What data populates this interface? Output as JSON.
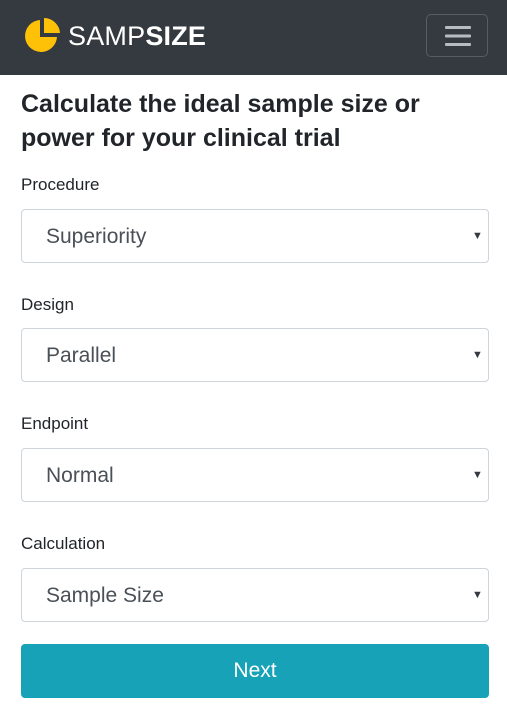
{
  "navbar": {
    "brand_light": "SAMP",
    "brand_bold": "SIZE",
    "logo_icon": "pie-chart-icon",
    "toggler_icon": "hamburger-icon",
    "logo_color": "#ffc107",
    "background": "#343a40"
  },
  "main": {
    "heading": "Calculate the ideal sample size or power for your clinical trial"
  },
  "form": {
    "procedure": {
      "label": "Procedure",
      "value": "Superiority",
      "caret": "▼"
    },
    "design": {
      "label": "Design",
      "value": "Parallel",
      "caret": "▼"
    },
    "endpoint": {
      "label": "Endpoint",
      "value": "Normal",
      "caret": "▼"
    },
    "calculation": {
      "label": "Calculation",
      "value": "Sample Size",
      "caret": "▼"
    }
  },
  "actions": {
    "next_label": "Next",
    "button_color": "#17a2b8"
  }
}
